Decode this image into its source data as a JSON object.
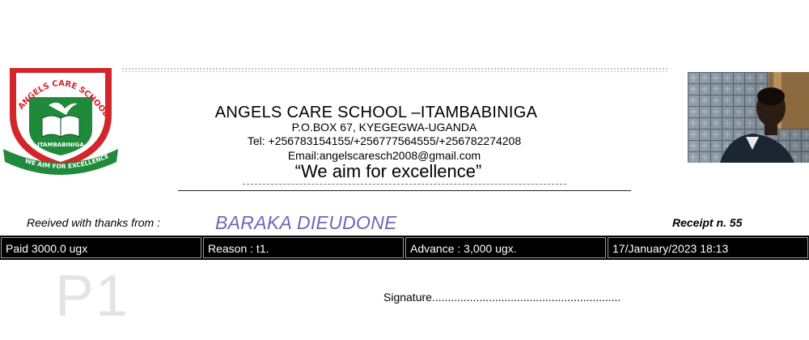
{
  "header": {
    "school_name": "ANGELS CARE SCHOOL –ITAMBABINIGA",
    "po_box": "P.O.BOX 67, KYEGEGWA-UGANDA",
    "tel": "Tel: +256783154155/+256777564555/+256782274208",
    "email": "Email:angelscaresch2008@gmail.com",
    "motto": "“We aim for excellence”"
  },
  "logo": {
    "top_text": "ANGELS CARE SCHOOLS",
    "center_text": "ITAMBABINIGA",
    "ribbon_text": "WE AIM FOR EXCELLENCE",
    "colors": {
      "green": "#1f8a3a",
      "red": "#d4252a",
      "white": "#ffffff"
    }
  },
  "receipt": {
    "received_label": "Reeived with thanks from :",
    "payer_name": "BARAKA DIEUDONE",
    "receipt_number": "Receipt n. 55",
    "paid": "Paid 3000.0 ugx",
    "reason": "Reason : t1.",
    "advance": "Advance : 3,000 ugx.",
    "date": "17/January/2023 18:13"
  },
  "footer": {
    "class_mark": "P1",
    "signature": "Signature............................................................"
  },
  "colors": {
    "payer_name": "#6a6ab7",
    "bar_background": "#000000",
    "bar_text": "#ffffff"
  }
}
